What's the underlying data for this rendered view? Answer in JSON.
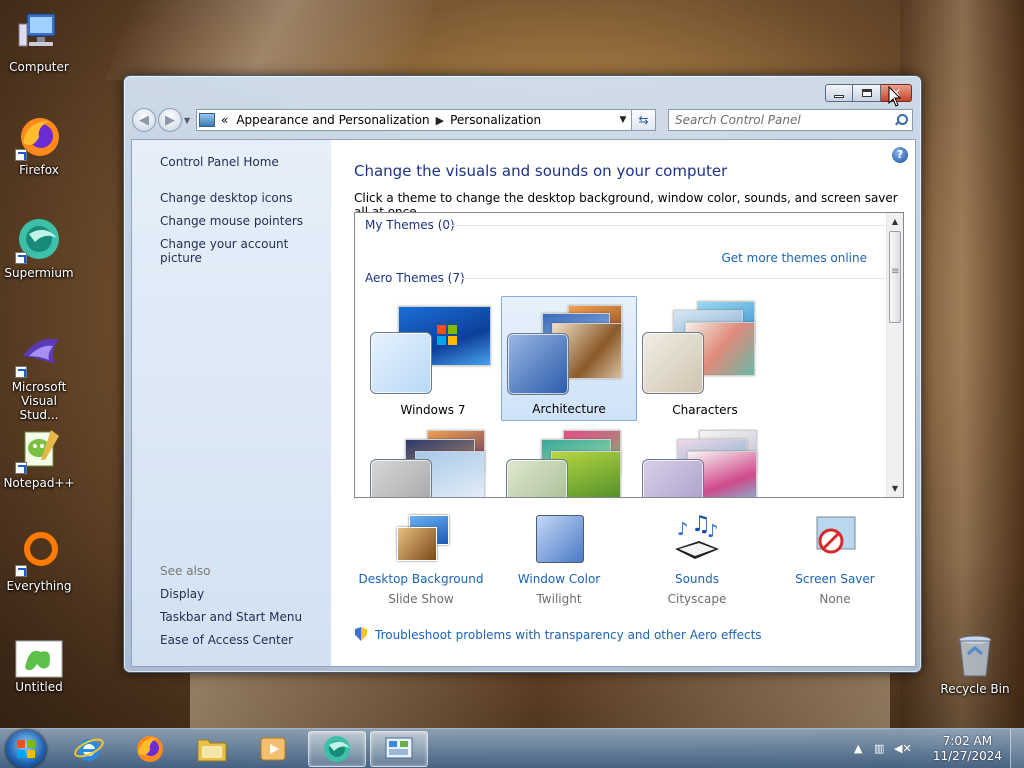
{
  "desktop": {
    "icons": [
      {
        "label": "Computer",
        "icon": "computer-icon"
      },
      {
        "label": "Firefox",
        "icon": "firefox-icon"
      },
      {
        "label": "Supermium",
        "icon": "supermium-icon"
      },
      {
        "label": "Microsoft Visual Stud...",
        "icon": "visual-studio-icon"
      },
      {
        "label": "Notepad++",
        "icon": "notepadpp-icon"
      },
      {
        "label": "Everything",
        "icon": "everything-icon"
      },
      {
        "label": "Untitled",
        "icon": "image-file-icon"
      },
      {
        "label": "Recycle Bin",
        "icon": "recycle-bin-icon"
      }
    ]
  },
  "window": {
    "address": {
      "prefix": "«",
      "crumb1": "Appearance and Personalization",
      "crumb2": "Personalization"
    },
    "search": {
      "placeholder": "Search Control Panel"
    },
    "left_pane": {
      "home": "Control Panel Home",
      "links": [
        "Change desktop icons",
        "Change mouse pointers",
        "Change your account picture"
      ],
      "see_also_title": "See also",
      "see_also": [
        "Display",
        "Taskbar and Start Menu",
        "Ease of Access Center"
      ]
    },
    "main": {
      "title": "Change the visuals and sounds on your computer",
      "description": "Click a theme to change the desktop background, window color, sounds, and screen saver all at once.",
      "my_themes": "My Themes (0)",
      "get_more": "Get more themes online",
      "aero_themes": "Aero Themes (7)",
      "themes": [
        {
          "name": "Windows 7",
          "selected": false
        },
        {
          "name": "Architecture",
          "selected": true
        },
        {
          "name": "Characters",
          "selected": false
        }
      ],
      "bottom": [
        {
          "label": "Desktop Background",
          "value": "Slide Show",
          "icon": "desktop-background-icon"
        },
        {
          "label": "Window Color",
          "value": "Twilight",
          "icon": "window-color-icon"
        },
        {
          "label": "Sounds",
          "value": "Cityscape",
          "icon": "sounds-icon"
        },
        {
          "label": "Screen Saver",
          "value": "None",
          "icon": "screen-saver-icon"
        }
      ],
      "troubleshoot": "Troubleshoot problems with transparency and other Aero effects"
    }
  },
  "taskbar": {
    "time": "7:02 AM",
    "date": "11/27/2024",
    "pinned": [
      "internet-explorer-icon",
      "firefox-icon",
      "file-explorer-icon",
      "media-player-icon",
      "supermium-icon",
      "control-panel-icon"
    ]
  },
  "colors": {
    "link": "#1a63b6",
    "title": "#1e3287",
    "left_pane": "#dfe9f5"
  }
}
